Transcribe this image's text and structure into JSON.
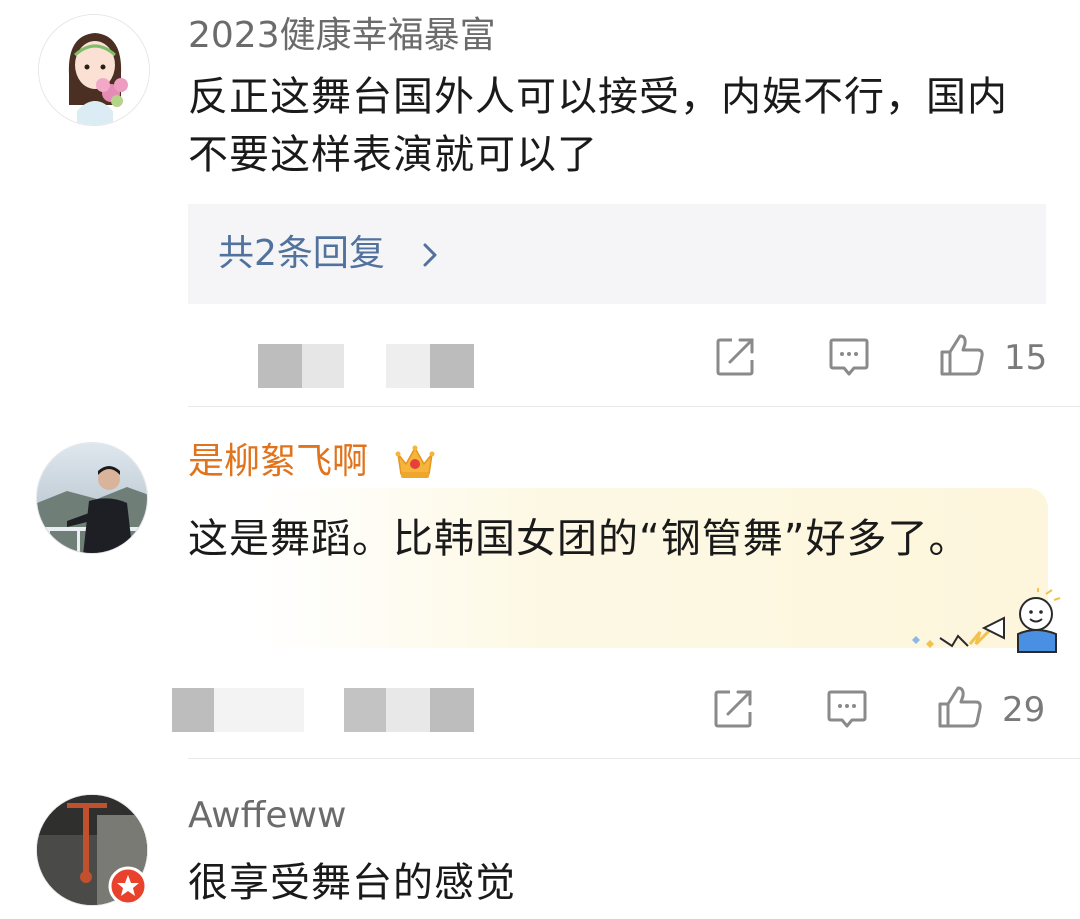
{
  "comments": [
    {
      "username": "2023健康幸福暴富",
      "text": "反正这舞台国外人可以接受，内娱不行，国内不要这样表演就可以了",
      "replies_label": "共2条回复",
      "like_count": "15"
    },
    {
      "username": "是柳絮飞啊",
      "text": "这是舞蹈。比韩国女团的“钢管舞”好多了。",
      "like_count": "29"
    },
    {
      "username": "Awffeww",
      "text": "很享受舞台的感觉"
    }
  ],
  "colors": {
    "vip_name": "#e0731c",
    "reply_link": "#52729e",
    "text": "#1a1a1a",
    "meta": "#6b6b6b"
  },
  "icons": [
    "share-icon",
    "comment-icon",
    "like-icon",
    "chevron-right-icon",
    "crown-icon",
    "verified-badge-icon"
  ]
}
